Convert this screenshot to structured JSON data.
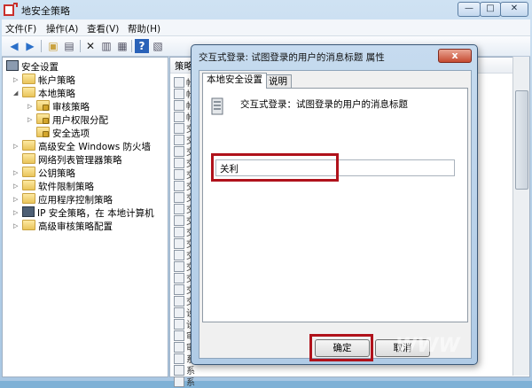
{
  "window": {
    "title": "地安全策略"
  },
  "menu": [
    "文件(F)",
    "操作(A)",
    "查看(V)",
    "帮助(H)"
  ],
  "tree": {
    "root": "安全设置",
    "items": [
      {
        "label": "帐户策略"
      },
      {
        "label": "本地策略"
      },
      {
        "label": "审核策略"
      },
      {
        "label": "用户权限分配"
      },
      {
        "label": "安全选项"
      },
      {
        "label": "高级安全 Windows 防火墙"
      },
      {
        "label": "网络列表管理器策略"
      },
      {
        "label": "公钥策略"
      },
      {
        "label": "软件限制策略"
      },
      {
        "label": "应用程序控制策略"
      },
      {
        "label": "IP 安全策略，在 本地计算机"
      },
      {
        "label": "高级审核策略配置"
      }
    ]
  },
  "list": {
    "header": "策略",
    "rows": [
      "帐",
      "帐",
      "帐",
      "帐",
      "交",
      "交",
      "交",
      "交",
      "交",
      "交",
      "交",
      "交",
      "交",
      "交",
      "交",
      "交",
      "交",
      "交",
      "交",
      "交",
      "设",
      "设",
      "审",
      "审",
      "系",
      "系",
      "系"
    ]
  },
  "dialog": {
    "title": "交互式登录: 试图登录的用户的消息标题 属性",
    "close": "x",
    "tabs": [
      "本地安全设置",
      "说明"
    ],
    "policy_name": "交互式登录：试图登录的用户的消息标题",
    "value": "关利",
    "ok": "确定",
    "cancel": "取消"
  },
  "watermark": "WWW"
}
